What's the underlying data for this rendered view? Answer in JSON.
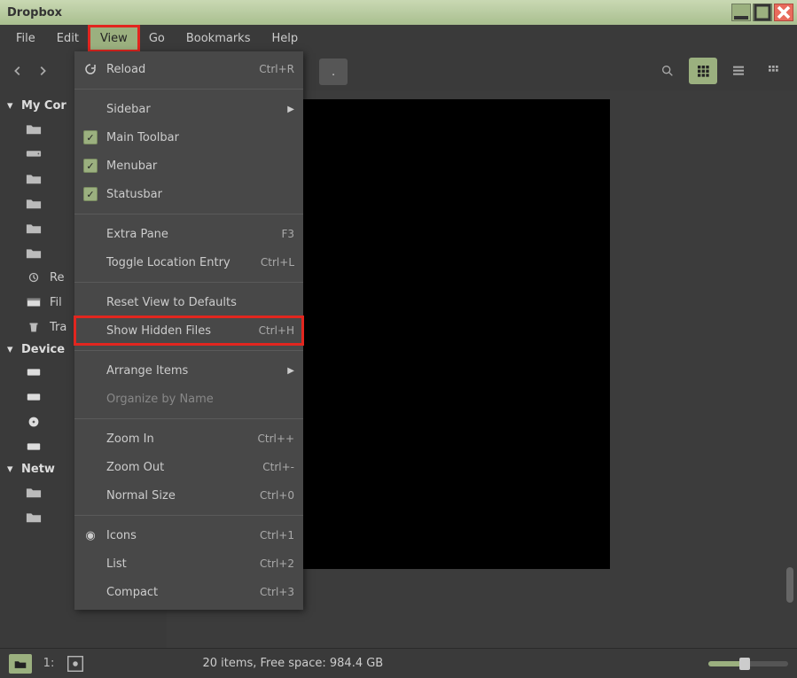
{
  "window": {
    "title": "Dropbox"
  },
  "menubar": {
    "items": [
      "File",
      "Edit",
      "View",
      "Go",
      "Bookmarks",
      "Help"
    ],
    "active": "View"
  },
  "breadcrumb": {
    "segment": "."
  },
  "view_menu": {
    "reload": {
      "label": "Reload",
      "accel": "Ctrl+R"
    },
    "sidebar": {
      "label": "Sidebar"
    },
    "main_toolbar": {
      "label": "Main Toolbar",
      "checked": true
    },
    "menubar": {
      "label": "Menubar",
      "checked": true
    },
    "statusbar": {
      "label": "Statusbar",
      "checked": true
    },
    "extra_pane": {
      "label": "Extra Pane",
      "accel": "F3"
    },
    "toggle_location": {
      "label": "Toggle Location Entry",
      "accel": "Ctrl+L"
    },
    "reset_view": {
      "label": "Reset View to Defaults"
    },
    "show_hidden": {
      "label": "Show Hidden Files",
      "accel": "Ctrl+H"
    },
    "arrange": {
      "label": "Arrange Items"
    },
    "organize": {
      "label": "Organize by Name"
    },
    "zoom_in": {
      "label": "Zoom In",
      "accel": "Ctrl++"
    },
    "zoom_out": {
      "label": "Zoom Out",
      "accel": "Ctrl+-"
    },
    "normal_size": {
      "label": "Normal Size",
      "accel": "Ctrl+0"
    },
    "icons": {
      "label": "Icons",
      "accel": "Ctrl+1"
    },
    "list": {
      "label": "List",
      "accel": "Ctrl+2"
    },
    "compact": {
      "label": "Compact",
      "accel": "Ctrl+3"
    }
  },
  "sidebar": {
    "sections": [
      {
        "title": "My Cor",
        "items": [
          {
            "icon": "folder",
            "label": ""
          },
          {
            "icon": "drive",
            "label": ""
          },
          {
            "icon": "folder",
            "label": ""
          },
          {
            "icon": "folder",
            "label": ""
          },
          {
            "icon": "folder",
            "label": ""
          },
          {
            "icon": "folder",
            "label": ""
          },
          {
            "icon": "recent",
            "label": "Re"
          },
          {
            "icon": "filesystem",
            "label": "Fil"
          },
          {
            "icon": "trash",
            "label": "Tra"
          }
        ]
      },
      {
        "title": "Device",
        "items": [
          {
            "icon": "disk",
            "label": ""
          },
          {
            "icon": "disk",
            "label": ""
          },
          {
            "icon": "optical",
            "label": ""
          },
          {
            "icon": "disk",
            "label": ""
          }
        ]
      },
      {
        "title": "Netw",
        "items": [
          {
            "icon": "folder",
            "label": ""
          },
          {
            "icon": "folder",
            "label": ""
          }
        ]
      }
    ]
  },
  "statusbar": {
    "text": "20 items, Free space: 984.4 GB",
    "tree_label": "1:"
  },
  "colors": {
    "accent": "#9bb07f",
    "highlight": "#e2261f"
  }
}
